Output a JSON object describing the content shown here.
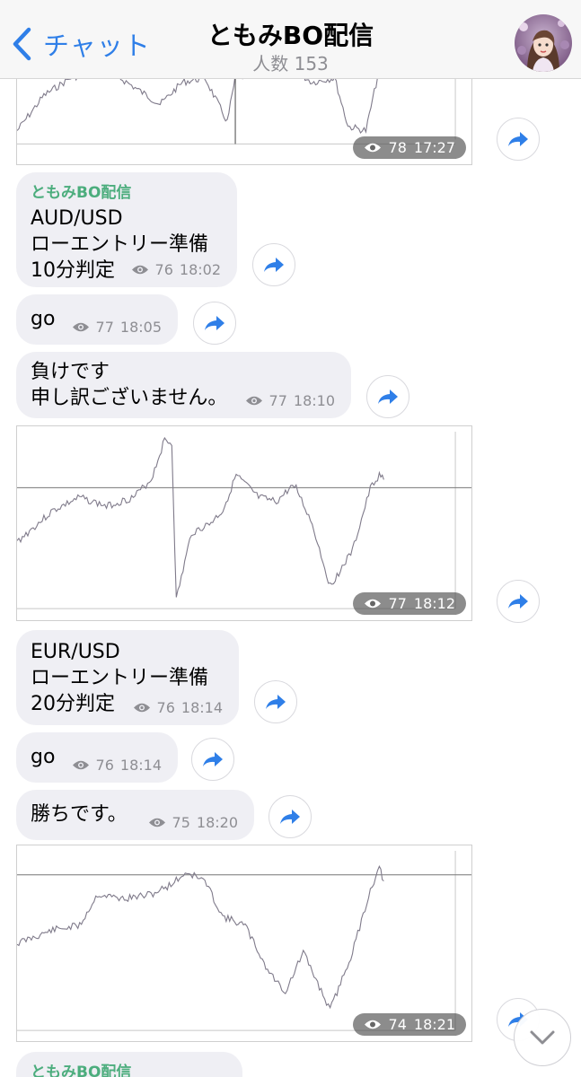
{
  "header": {
    "back_label": "チャット",
    "title": "ともみBO配信",
    "subtitle": "人数 153"
  },
  "colors": {
    "accent": "#2f7fe8",
    "sender": "#4cad7d",
    "bubble": "#efeff4",
    "meta": "#8e8e93"
  },
  "messages": [
    {
      "type": "photo",
      "views": "78",
      "time": "17:27"
    },
    {
      "type": "text",
      "sender": "ともみBO配信",
      "text": "AUD/USD\nローエントリー準備\n10分判定",
      "views": "76",
      "time": "18:02"
    },
    {
      "type": "text",
      "text": "go",
      "views": "77",
      "time": "18:05"
    },
    {
      "type": "text",
      "text": "負けです\n申し訳ございません。",
      "views": "77",
      "time": "18:10"
    },
    {
      "type": "photo",
      "views": "77",
      "time": "18:12"
    },
    {
      "type": "text",
      "text": "EUR/USD\nローエントリー準備\n20分判定",
      "views": "76",
      "time": "18:14"
    },
    {
      "type": "text",
      "text": "go",
      "views": "76",
      "time": "18:14"
    },
    {
      "type": "text",
      "text": "勝ちです。",
      "views": "75",
      "time": "18:20"
    },
    {
      "type": "photo",
      "views": "74",
      "time": "18:21"
    },
    {
      "type": "text",
      "sender": "ともみBO配信"
    }
  ],
  "icons": {
    "back": "chevron-left-icon",
    "views": "eye-icon",
    "share": "share-arrow-icon",
    "scroll": "chevron-down-icon"
  }
}
